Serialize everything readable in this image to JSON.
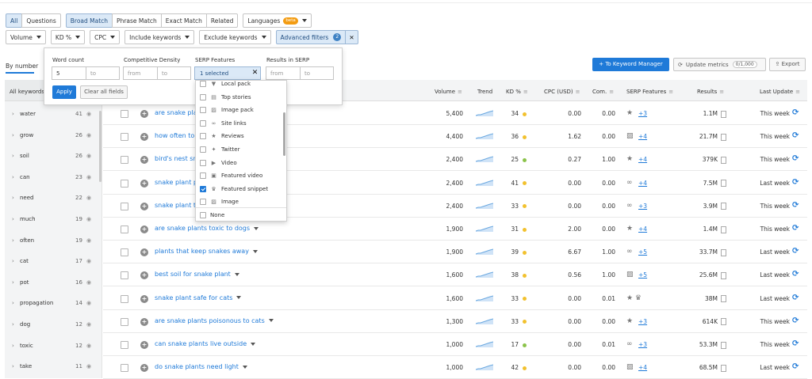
{
  "filters": {
    "intent_tabs": [
      "All",
      "Questions"
    ],
    "match_tabs": [
      "Broad Match",
      "Phrase Match",
      "Exact Match",
      "Related"
    ],
    "languages": "Languages",
    "beta": "beta",
    "row2": [
      "Volume",
      "KD %",
      "CPC",
      "Include keywords",
      "Exclude keywords"
    ],
    "advanced": "Advanced filters",
    "advanced_count": "2",
    "advanced_clear": "✕"
  },
  "popup": {
    "word_count_label": "Word count",
    "word_count_from": "5",
    "word_count_to_placeholder": "to",
    "density_label": "Competitive Density",
    "density_from_placeholder": "from",
    "density_to_placeholder": "to",
    "serp_label": "SERP Features",
    "serp_value": "1 selected",
    "serp_clear": "✕",
    "results_label": "Results in SERP",
    "results_from_placeholder": "from",
    "results_to_placeholder": "to",
    "apply": "Apply",
    "clear_all": "Clear all fields"
  },
  "serp_dropdown": {
    "items": [
      {
        "label": "Local pack",
        "icon": "pin-icon",
        "glyph": "▼",
        "checked": false
      },
      {
        "label": "Top stories",
        "icon": "news-icon",
        "glyph": "▤",
        "checked": false
      },
      {
        "label": "Image pack",
        "icon": "image-icon",
        "glyph": "▨",
        "checked": false
      },
      {
        "label": "Site links",
        "icon": "link-icon",
        "glyph": "∞",
        "checked": false
      },
      {
        "label": "Reviews",
        "icon": "star-icon",
        "glyph": "★",
        "checked": false
      },
      {
        "label": "Twitter",
        "icon": "twitter-icon",
        "glyph": "✦",
        "checked": false
      },
      {
        "label": "Video",
        "icon": "video-icon",
        "glyph": "▶",
        "checked": false
      },
      {
        "label": "Featured video",
        "icon": "featured-video-icon",
        "glyph": "▣",
        "checked": false
      },
      {
        "label": "Featured snippet",
        "icon": "crown-icon",
        "glyph": "♛",
        "checked": true
      },
      {
        "label": "Image",
        "icon": "image-icon",
        "glyph": "▨",
        "checked": false
      }
    ],
    "none": "None"
  },
  "toolbar": {
    "by_number": "By number",
    "to_keyword_manager": "+ To Keyword Manager",
    "update_metrics": "Update metrics",
    "update_count": "0/1,000",
    "export": "Export"
  },
  "groups": {
    "header": "All keywords",
    "items": [
      {
        "kw": "water",
        "count": "41"
      },
      {
        "kw": "grow",
        "count": "26"
      },
      {
        "kw": "soil",
        "count": "26"
      },
      {
        "kw": "can",
        "count": "23"
      },
      {
        "kw": "need",
        "count": "22"
      },
      {
        "kw": "much",
        "count": "19"
      },
      {
        "kw": "often",
        "count": "19"
      },
      {
        "kw": "cat",
        "count": "17"
      },
      {
        "kw": "pot",
        "count": "16"
      },
      {
        "kw": "propagation",
        "count": "14"
      },
      {
        "kw": "dog",
        "count": "12"
      },
      {
        "kw": "toxic",
        "count": "12"
      },
      {
        "kw": "take",
        "count": "11"
      }
    ]
  },
  "table": {
    "headers": {
      "volume": "Volume",
      "trend": "Trend",
      "kd": "KD %",
      "cpc": "CPC (USD)",
      "com": "Com.",
      "serp": "SERP Features",
      "results": "Results",
      "last_update": "Last Update"
    },
    "rows": [
      {
        "kw": "are snake pla",
        "caret": false,
        "volume": "5,400",
        "kd": "34",
        "kd_color": "#f2c12e",
        "cpc": "0.00",
        "com": "0.00",
        "serp_icon": "star-icon",
        "serp_glyph": "★",
        "serp_plus": "+3",
        "results": "1.1M",
        "update": "This week"
      },
      {
        "kw": "how often to",
        "caret": false,
        "volume": "4,400",
        "kd": "36",
        "kd_color": "#f2c12e",
        "cpc": "1.62",
        "com": "0.00",
        "serp_icon": "image-icon",
        "serp_glyph": "▨",
        "serp_plus": "+4",
        "results": "21.7M",
        "update": "This week"
      },
      {
        "kw": "bird's nest sn",
        "caret": false,
        "volume": "2,400",
        "kd": "25",
        "kd_color": "#8bc34a",
        "cpc": "0.27",
        "com": "1.00",
        "serp_icon": "star-icon",
        "serp_glyph": "★",
        "serp_plus": "+4",
        "results": "379K",
        "update": "This week"
      },
      {
        "kw": "snake plant p",
        "caret": false,
        "volume": "2,400",
        "kd": "41",
        "kd_color": "#f2c12e",
        "cpc": "0.00",
        "com": "0.00",
        "serp_icon": "link-icon",
        "serp_glyph": "∞",
        "serp_plus": "+4",
        "results": "7.5M",
        "update": "Last week"
      },
      {
        "kw": "snake plant t",
        "caret": false,
        "volume": "2,400",
        "kd": "33",
        "kd_color": "#f2c12e",
        "cpc": "0.00",
        "com": "0.00",
        "serp_icon": "link-icon",
        "serp_glyph": "∞",
        "serp_plus": "+3",
        "results": "3.9M",
        "update": "This week"
      },
      {
        "kw": "are snake plants toxic to dogs",
        "caret": true,
        "volume": "1,900",
        "kd": "31",
        "kd_color": "#f2c12e",
        "cpc": "2.00",
        "com": "0.00",
        "serp_icon": "star-icon",
        "serp_glyph": "★",
        "serp_plus": "+4",
        "results": "1.4M",
        "update": "This week"
      },
      {
        "kw": "plants that keep snakes away",
        "caret": true,
        "volume": "1,900",
        "kd": "39",
        "kd_color": "#f2c12e",
        "cpc": "6.67",
        "com": "1.00",
        "serp_icon": "link-icon",
        "serp_glyph": "∞",
        "serp_plus": "+5",
        "results": "33.7M",
        "update": "Last week"
      },
      {
        "kw": "best soil for snake plant",
        "caret": true,
        "volume": "1,600",
        "kd": "38",
        "kd_color": "#f2c12e",
        "cpc": "0.56",
        "com": "1.00",
        "serp_icon": "image-icon",
        "serp_glyph": "▨",
        "serp_plus": "+5",
        "results": "25.6M",
        "update": "Last week"
      },
      {
        "kw": "snake plant safe for cats",
        "caret": true,
        "volume": "1,600",
        "kd": "33",
        "kd_color": "#f2c12e",
        "cpc": "0.00",
        "com": "0.01",
        "serp_icon": "star-icon",
        "serp_glyph": "★ ♛",
        "serp_plus": "",
        "results": "38M",
        "update": "Last week"
      },
      {
        "kw": "are snake plants poisonous to cats",
        "caret": true,
        "volume": "1,300",
        "kd": "33",
        "kd_color": "#f2c12e",
        "cpc": "0.00",
        "com": "0.00",
        "serp_icon": "star-icon",
        "serp_glyph": "★",
        "serp_plus": "+3",
        "results": "614K",
        "update": "This week"
      },
      {
        "kw": "can snake plants live outside",
        "caret": true,
        "volume": "1,000",
        "kd": "17",
        "kd_color": "#8bc34a",
        "cpc": "0.00",
        "com": "0.01",
        "serp_icon": "link-icon",
        "serp_glyph": "∞",
        "serp_plus": "+3",
        "results": "53.3M",
        "update": "This week"
      },
      {
        "kw": "do snake plants need light",
        "caret": true,
        "volume": "1,000",
        "kd": "42",
        "kd_color": "#f2c12e",
        "cpc": "0.00",
        "com": "0.00",
        "serp_icon": "image-icon",
        "serp_glyph": "▨",
        "serp_plus": "+4",
        "results": "68.5M",
        "update": "Last week"
      }
    ]
  }
}
